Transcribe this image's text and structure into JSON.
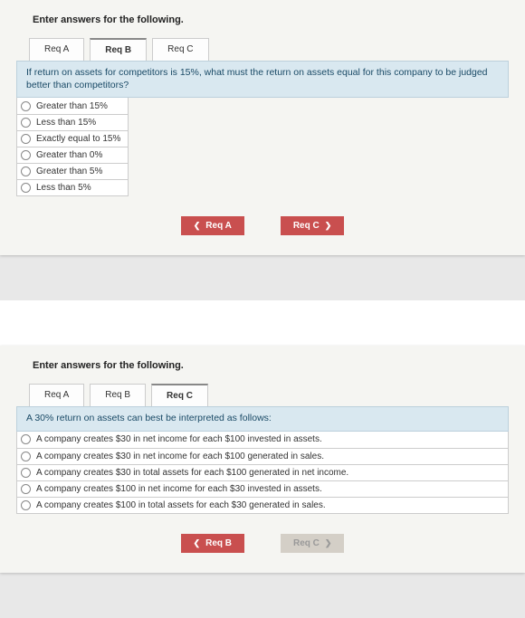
{
  "section1": {
    "instruction": "Enter answers for the following.",
    "tabs": [
      "Req A",
      "Req B",
      "Req C"
    ],
    "activeTab": 1,
    "question": "If return on assets for competitors is 15%, what must the return on assets equal for this company to be judged better than competitors?",
    "options": [
      "Greater than 15%",
      "Less than 15%",
      "Exactly equal to 15%",
      "Greater than 0%",
      "Greater than 5%",
      "Less than 5%"
    ],
    "navPrev": "Req A",
    "navNext": "Req C"
  },
  "section2": {
    "instruction": "Enter answers for the following.",
    "tabs": [
      "Req A",
      "Req B",
      "Req C"
    ],
    "activeTab": 2,
    "question": "A 30% return on assets can best be interpreted as follows:",
    "options": [
      "A company creates $30 in net income for each $100 invested in assets.",
      "A company creates $30 in net income for each $100 generated in sales.",
      "A company creates $30 in total assets for each $100 generated in net income.",
      "A company creates $100 in net income for each $30 invested in assets.",
      "A company creates $100 in total assets for each $30 generated in sales."
    ],
    "navPrev": "Req B",
    "navNext": "Req C"
  }
}
